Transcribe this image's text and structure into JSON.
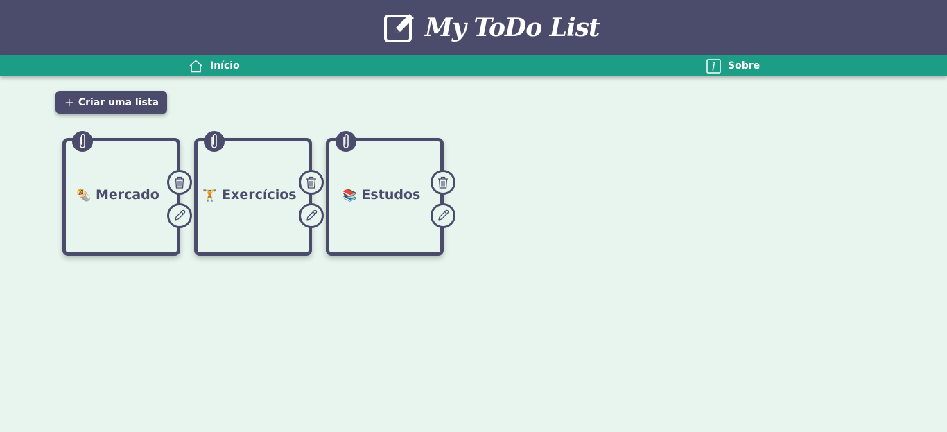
{
  "header": {
    "title": "My ToDo List",
    "logo_icon": "edit-square-icon"
  },
  "nav": {
    "home_label": "Início",
    "home_icon": "house-icon",
    "about_label": "Sobre",
    "about_icon": "info-icon"
  },
  "create_button": {
    "label": "Criar uma lista",
    "icon": "plus-icon"
  },
  "lists": [
    {
      "emoji": "🌯",
      "name": "Mercado"
    },
    {
      "emoji": "🏋",
      "name": "Exercícios"
    },
    {
      "emoji": "📚",
      "name": "Estudos"
    }
  ],
  "card_actions": {
    "delete_icon": "trash-icon",
    "edit_icon": "pencil-icon",
    "clip_icon": "paperclip-icon"
  },
  "colors": {
    "header": "#4b4b6b",
    "navbar": "#1c9e86",
    "background": "#e8f5ee",
    "text_light": "#ffffff"
  }
}
